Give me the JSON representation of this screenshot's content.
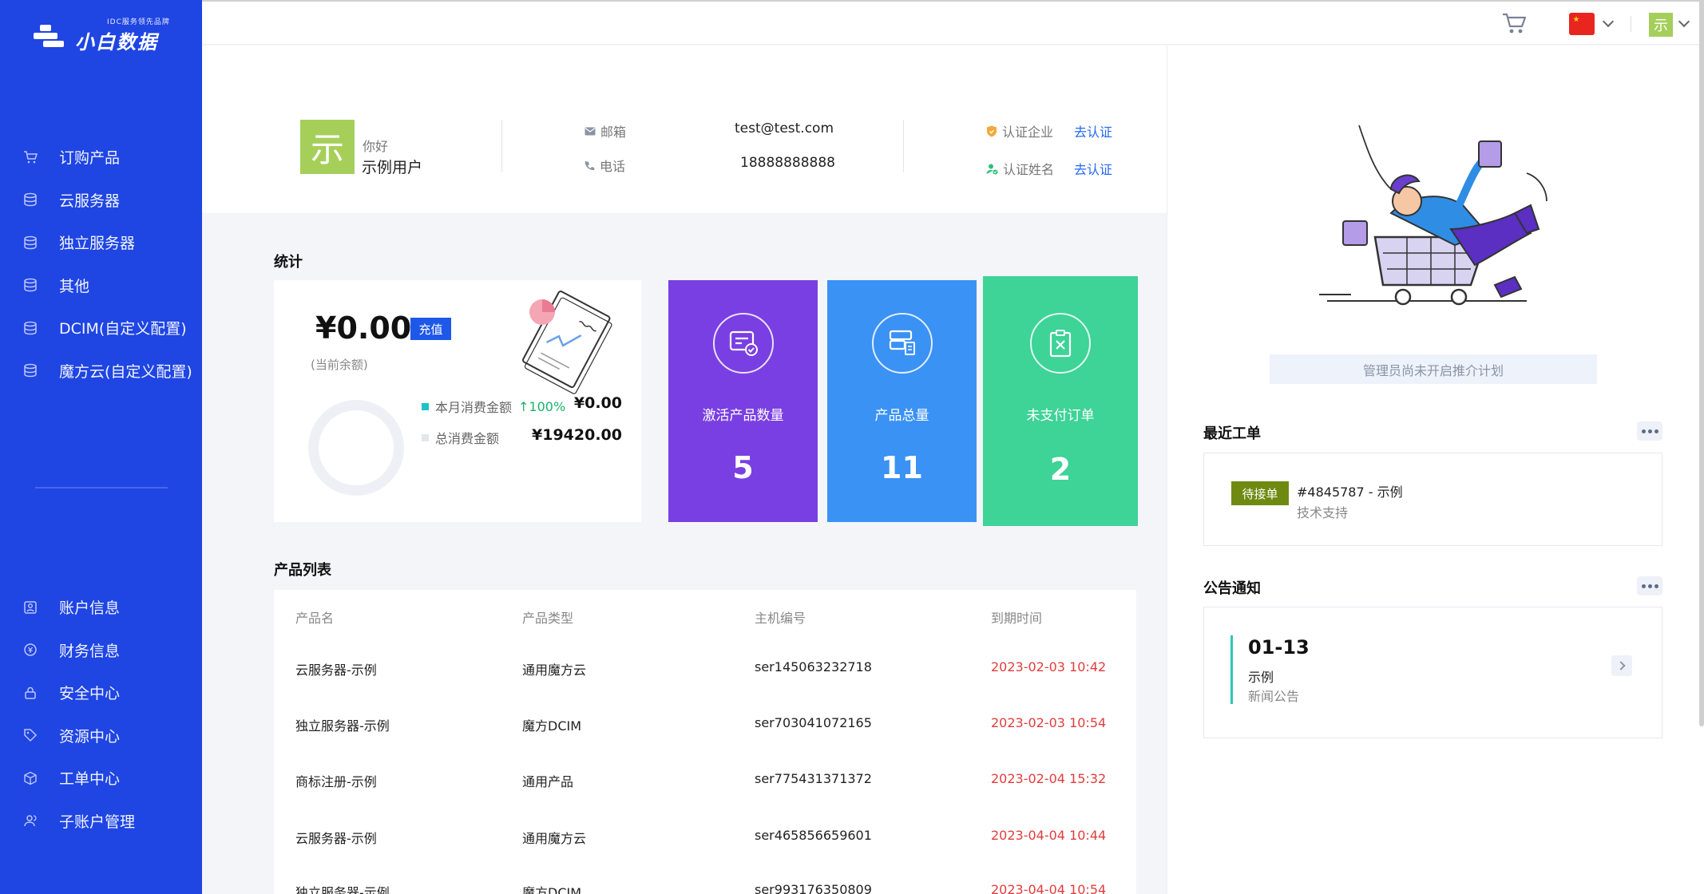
{
  "brand": {
    "tagline": "IDC服务领先品牌",
    "name": "小白数据"
  },
  "sidebar": {
    "top_items": [
      {
        "label": "订购产品",
        "icon": "cart-icon"
      },
      {
        "label": "云服务器",
        "icon": "server-icon"
      },
      {
        "label": "独立服务器",
        "icon": "server-icon"
      },
      {
        "label": "其他",
        "icon": "server-icon"
      },
      {
        "label": "DCIM(自定义配置)",
        "icon": "server-icon"
      },
      {
        "label": "魔方云(自定义配置)",
        "icon": "server-icon"
      }
    ],
    "bottom_items": [
      {
        "label": "账户信息",
        "icon": "account-icon"
      },
      {
        "label": "财务信息",
        "icon": "finance-icon"
      },
      {
        "label": "安全中心",
        "icon": "lock-icon"
      },
      {
        "label": "资源中心",
        "icon": "tag-icon"
      },
      {
        "label": "工单中心",
        "icon": "box-icon"
      },
      {
        "label": "子账户管理",
        "icon": "users-icon"
      }
    ]
  },
  "topbar": {
    "avatar_char": "示",
    "flag_icon": "china-flag-icon"
  },
  "user": {
    "avatar_char": "示",
    "greeting": "你好",
    "name": "示例用户",
    "email_label": "邮箱",
    "email": "test@test.com",
    "phone_label": "电话",
    "phone": "18888888888",
    "company_label": "认证企业",
    "company_action": "去认证",
    "realname_label": "认证姓名",
    "realname_action": "去认证"
  },
  "stats": {
    "title": "统计",
    "balance": "¥0.00",
    "recharge": "充值",
    "balance_label": "(当前余额)",
    "month_label": "本月消费金额",
    "month_pct": "↑100%",
    "month_value": "¥0.00",
    "total_label": "总消费金额",
    "total_value": "¥19420.00",
    "tiles": [
      {
        "label": "激活产品数量",
        "value": "5",
        "color": "#7a3fe2"
      },
      {
        "label": "产品总量",
        "value": "11",
        "color": "#3a92f4"
      },
      {
        "label": "未支付订单",
        "value": "2",
        "color": "#3ed397"
      }
    ]
  },
  "products": {
    "title": "产品列表",
    "columns": [
      "产品名",
      "产品类型",
      "主机编号",
      "到期时间"
    ],
    "rows": [
      [
        "云服务器-示例",
        "通用魔方云",
        "ser145063232718",
        "2023-02-03 10:42"
      ],
      [
        "独立服务器-示例",
        "魔方DCIM",
        "ser703041072165",
        "2023-02-03 10:54"
      ],
      [
        "商标注册-示例",
        "通用产品",
        "ser775431371372",
        "2023-02-04 15:32"
      ],
      [
        "云服务器-示例",
        "通用魔方云",
        "ser465856659601",
        "2023-04-04 10:44"
      ],
      [
        "独立服务器-示例",
        "魔方DCIM",
        "ser993176350809",
        "2023-04-04 10:54"
      ]
    ]
  },
  "right": {
    "promo": "管理员尚未开启推介计划",
    "tickets_title": "最近工单",
    "ticket": {
      "status": "待接单",
      "title": "#4845787 - 示例",
      "dept": "技术支持"
    },
    "notice_title": "公告通知",
    "notice": {
      "date": "01-13",
      "title": "示例",
      "type": "新闻公告"
    }
  }
}
